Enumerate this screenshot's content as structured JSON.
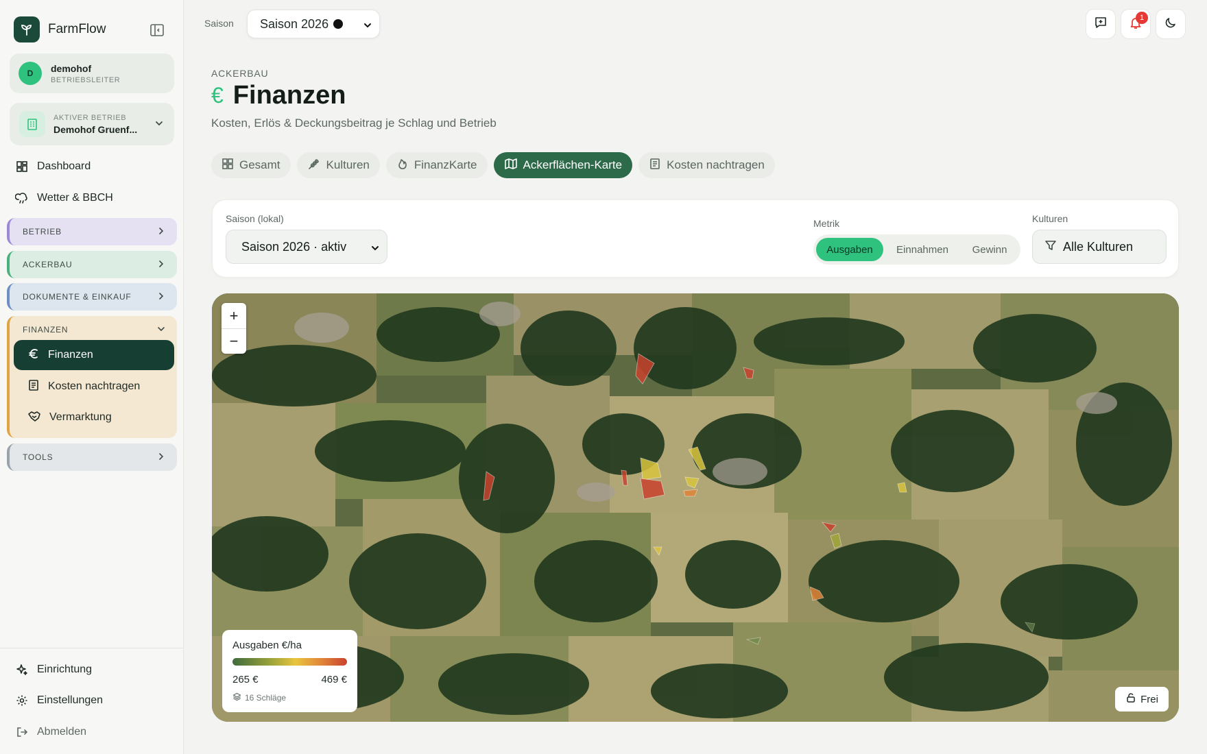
{
  "app": {
    "name": "FarmFlow"
  },
  "user": {
    "initial": "D",
    "name": "demohof",
    "role": "BETRIEBSLEITER"
  },
  "farm": {
    "label": "AKTIVER BETRIEB",
    "name": "Demohof Gruenf..."
  },
  "nav": {
    "dashboard": "Dashboard",
    "wetter": "Wetter & BBCH"
  },
  "sections": {
    "betrieb": "BETRIEB",
    "ackerbau": "ACKERBAU",
    "dokumente": "DOKUMENTE & EINKAUF",
    "finanzen": "FINANZEN",
    "tools": "TOOLS"
  },
  "finanzen_items": {
    "finanzen": "Finanzen",
    "kosten": "Kosten nachtragen",
    "vermarktung": "Vermarktung"
  },
  "footer_nav": {
    "einrichtung": "Einrichtung",
    "einstellungen": "Einstellungen",
    "abmelden": "Abmelden"
  },
  "topbar": {
    "season_label": "Saison",
    "season_value": "Saison 2026",
    "notification_count": "1"
  },
  "header": {
    "eyebrow": "ACKERBAU",
    "euro_symbol": "€",
    "title": "Finanzen",
    "subtitle": "Kosten, Erlös & Deckungsbeitrag je Schlag und Betrieb"
  },
  "tabs": [
    "Gesamt",
    "Kulturen",
    "FinanzKarte",
    "Ackerflächen-Karte",
    "Kosten nachtragen"
  ],
  "active_tab": "Ackerflächen-Karte",
  "filters": {
    "season_local_label": "Saison (lokal)",
    "season_local_value": "Saison 2026 · aktiv",
    "metric_label": "Metrik",
    "metric_options": [
      "Ausgaben",
      "Einnahmen",
      "Gewinn"
    ],
    "metric_selected": "Ausgaben",
    "kulturen_label": "Kulturen",
    "kulturen_value": "Alle Kulturen"
  },
  "map": {
    "zoom_in": "+",
    "zoom_out": "−",
    "legend_title": "Ausgaben €/ha",
    "legend_min": "265 €",
    "legend_max": "469 €",
    "legend_count": "16 Schläge",
    "lock_label": "Frei"
  },
  "colors": {
    "accent": "#2ec27e",
    "sidebar_active": "#173e33",
    "tab_active": "#2d6a4a"
  }
}
